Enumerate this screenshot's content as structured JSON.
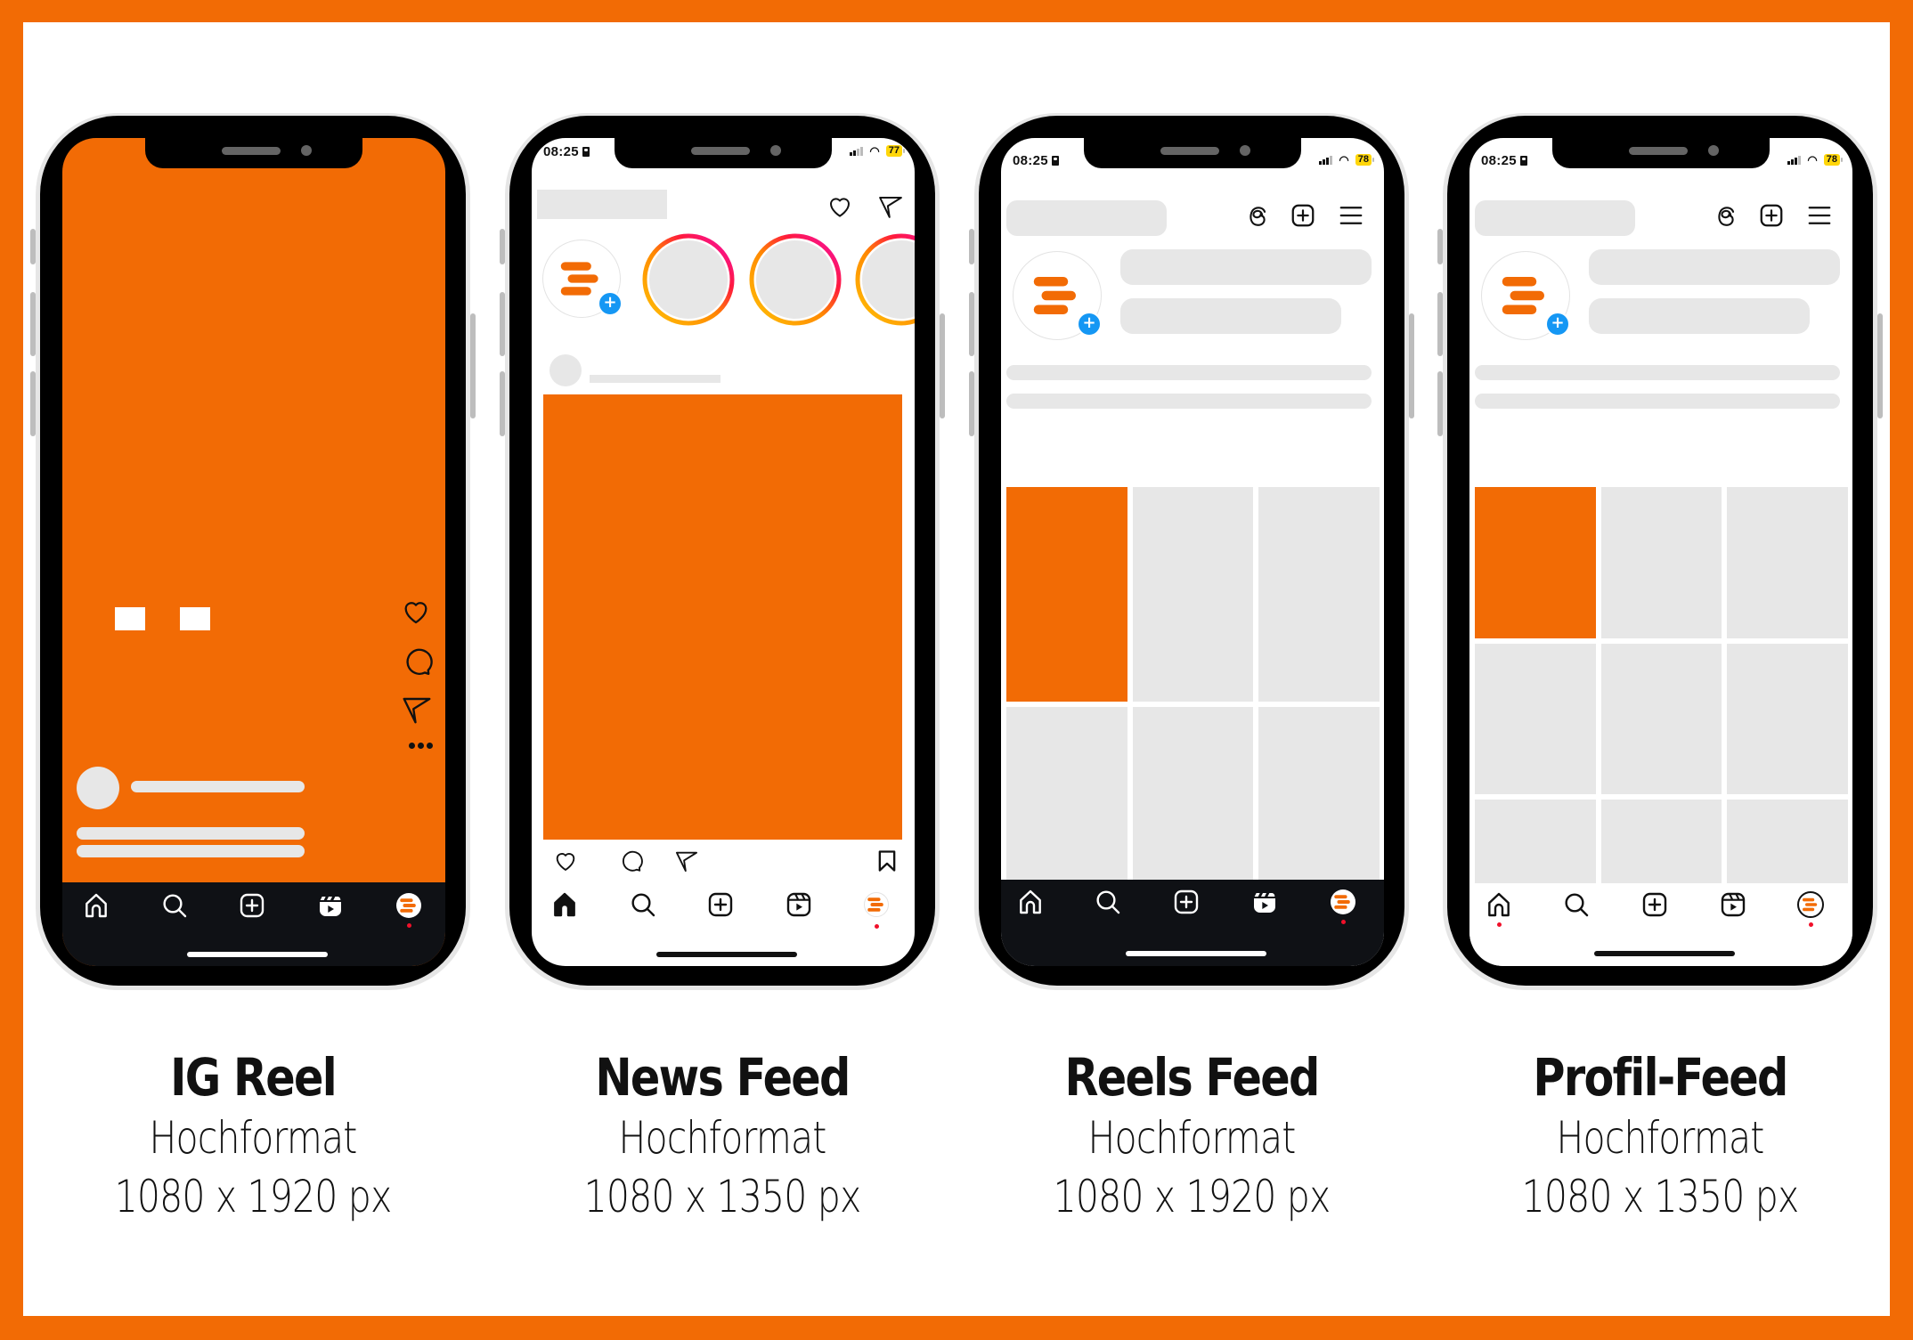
{
  "colors": {
    "brand_orange": "#F26B05",
    "placeholder_gray": "#E7E7E7",
    "dark_nav": "#0F1115",
    "badge_blue": "#1597F4",
    "notification_red": "#F0102A",
    "battery_yellow": "#FFD60A"
  },
  "phones": [
    {
      "id": "ig-reel",
      "status": null,
      "nav_icons": [
        "home-icon",
        "search-icon",
        "create-icon",
        "reels-icon",
        "profile-avatar"
      ],
      "side_actions": [
        "heart-icon",
        "comment-icon",
        "send-icon",
        "more-icon"
      ],
      "label": {
        "title": "IG Reel",
        "orientation": "Hochformat",
        "size": "1080 x 1920 px"
      }
    },
    {
      "id": "news-feed",
      "status": {
        "time": "08:25",
        "battery": "77"
      },
      "header_icons": [
        "heart-icon",
        "send-icon"
      ],
      "stories_count_visible": 4,
      "post_actions": [
        "heart-icon",
        "comment-icon",
        "send-icon",
        "bookmark-icon"
      ],
      "nav_icons": [
        "home-icon",
        "search-icon",
        "create-icon",
        "reels-icon",
        "profile-avatar"
      ],
      "label": {
        "title": "News Feed",
        "orientation": "Hochformat",
        "size": "1080 x 1350 px"
      }
    },
    {
      "id": "reels-feed",
      "status": {
        "time": "08:25",
        "battery": "78"
      },
      "header_icons": [
        "threads-icon",
        "create-icon",
        "menu-icon"
      ],
      "grid": {
        "columns": 3,
        "highlighted_index": 0,
        "cell_ratio": "9:16"
      },
      "nav_icons": [
        "home-icon",
        "search-icon",
        "create-icon",
        "reels-icon",
        "profile-avatar"
      ],
      "label": {
        "title": "Reels Feed",
        "orientation": "Hochformat",
        "size": "1080 x 1920 px"
      }
    },
    {
      "id": "profil-feed",
      "status": {
        "time": "08:25",
        "battery": "78"
      },
      "header_icons": [
        "threads-icon",
        "create-icon",
        "menu-icon"
      ],
      "grid": {
        "columns": 3,
        "highlighted_index": 0,
        "cell_ratio": "4:5"
      },
      "nav_icons": [
        "home-icon",
        "search-icon",
        "create-icon",
        "reels-icon",
        "profile-avatar"
      ],
      "label": {
        "title": "Profil-Feed",
        "orientation": "Hochformat",
        "size": "1080 x 1350 px"
      }
    }
  ]
}
